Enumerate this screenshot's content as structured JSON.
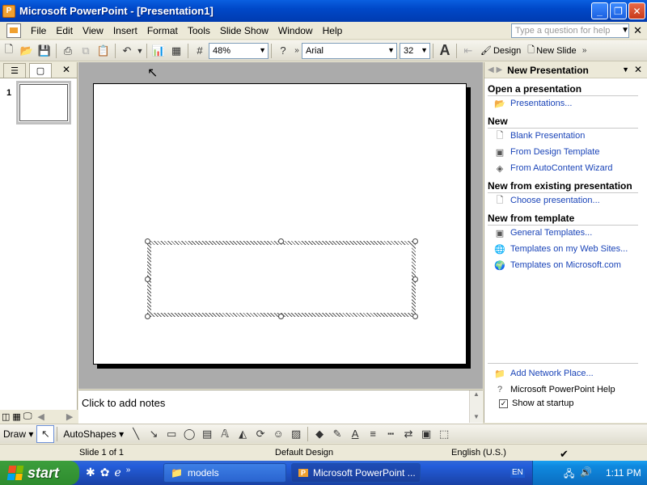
{
  "window": {
    "title": "Microsoft PowerPoint - [Presentation1]",
    "app_icon": "powerpoint-icon",
    "minimize": "_",
    "restore": "❐",
    "close": "✕"
  },
  "menubar": {
    "items": [
      "File",
      "Edit",
      "View",
      "Insert",
      "Format",
      "Tools",
      "Slide Show",
      "Window",
      "Help"
    ],
    "help_placeholder": "Type a question for help",
    "close": "✕"
  },
  "toolbar": {
    "zoom": "48%",
    "font": "Arial",
    "font_size": "32",
    "design_label": "Design",
    "new_slide_label": "New Slide"
  },
  "left_panel": {
    "close": "✕",
    "slide_number": "1"
  },
  "notes": {
    "placeholder": "Click to add notes"
  },
  "task_pane": {
    "title": "New Presentation",
    "close": "✕",
    "open_section": "Open a presentation",
    "open_links": [
      "Presentations..."
    ],
    "new_section": "New",
    "new_links": [
      "Blank Presentation",
      "From Design Template",
      "From AutoContent Wizard"
    ],
    "existing_section": "New from existing presentation",
    "existing_links": [
      "Choose presentation..."
    ],
    "template_section": "New from template",
    "template_links": [
      "General Templates...",
      "Templates on my Web Sites...",
      "Templates on Microsoft.com"
    ],
    "footer_links": [
      "Add Network Place...",
      "Microsoft PowerPoint Help"
    ],
    "show_at_startup": "Show at startup",
    "show_at_startup_checked": true
  },
  "drawbar": {
    "draw_label": "Draw",
    "autoshapes_label": "AutoShapes"
  },
  "statusbar": {
    "slide_info": "Slide 1 of 1",
    "design": "Default Design",
    "language": "English (U.S.)"
  },
  "taskbar": {
    "start_label": "start",
    "tasks": [
      {
        "label": "models",
        "active": false
      },
      {
        "label": "Microsoft PowerPoint ...",
        "active": true
      }
    ],
    "lang": "EN",
    "clock": "1:11 PM"
  }
}
